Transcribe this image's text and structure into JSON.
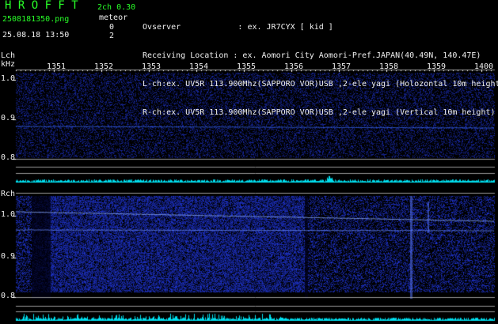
{
  "header": {
    "title": "H R O F F T",
    "filename": "2508181350.png",
    "datetime": "25.08.18 13:50",
    "mode": "2ch 0.30",
    "meteor_label": "meteor",
    "count_lch": "0",
    "count_rch": "2",
    "info_lines": [
      "Ovserver            : ex. JR7CYX [ kid ]",
      "Receiving Location : ex. Aomori City Aomori-Pref.JAPAN(40.49N, 140.47E)",
      "L-ch:ex. UV5R 113.900Mhz(SAPPORO VOR)USB ,2-ele yagi (Holozontal 10m height)",
      "R-ch:ex. UV5R 113.900Mhz(SAPPORO VOR)USB ,2-ele yagi (Vertical 10m height)"
    ]
  },
  "time_axis": [
    "1351",
    "1352",
    "1353",
    "1354",
    "1355",
    "1356",
    "1357",
    "1358",
    "1359",
    "1400"
  ],
  "lch": {
    "label": "Lch",
    "unit": "kHz",
    "ticks": [
      "1.0",
      "0.9",
      "0.8"
    ]
  },
  "rch": {
    "label": "Rch",
    "ticks": [
      "1.0",
      "0.9",
      "0.8"
    ]
  },
  "colors": {
    "accent_green": "#28ff28",
    "signal_cyan": "#00e0f0",
    "spectrum_blue": "#1a2aa0"
  }
}
